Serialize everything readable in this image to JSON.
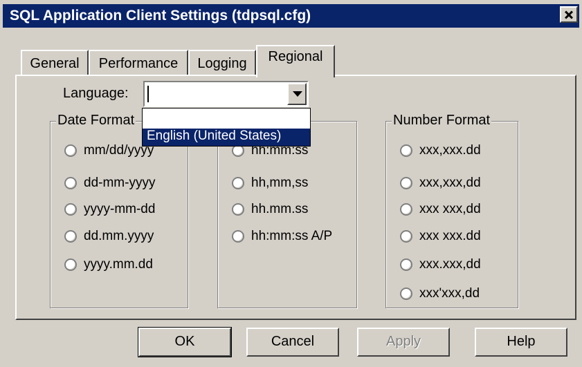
{
  "window": {
    "title": "SQL Application Client Settings (tdpsql.cfg)"
  },
  "tabs": [
    {
      "label": "General"
    },
    {
      "label": "Performance"
    },
    {
      "label": "Logging"
    },
    {
      "label": "Regional"
    }
  ],
  "language": {
    "label": "Language:",
    "value": "",
    "options": [
      "",
      "English (United States)"
    ],
    "selected_option": "English (United States)"
  },
  "date_format": {
    "title": "Date Format",
    "options": [
      "mm/dd/yyyy",
      "dd-mm-yyyy",
      "yyyy-mm-dd",
      "dd.mm.yyyy",
      "yyyy.mm.dd"
    ]
  },
  "time_format": {
    "options": [
      "hh:mm:ss",
      "hh,mm,ss",
      "hh.mm.ss",
      "hh:mm:ss A/P"
    ]
  },
  "number_format": {
    "title": "Number Format",
    "options": [
      "xxx,xxx.dd",
      "xxx,xxx,dd",
      "xxx xxx,dd",
      "xxx xxx.dd",
      "xxx.xxx,dd",
      "xxx'xxx,dd"
    ]
  },
  "buttons": {
    "ok": "OK",
    "cancel": "Cancel",
    "apply": "Apply",
    "help": "Help"
  }
}
